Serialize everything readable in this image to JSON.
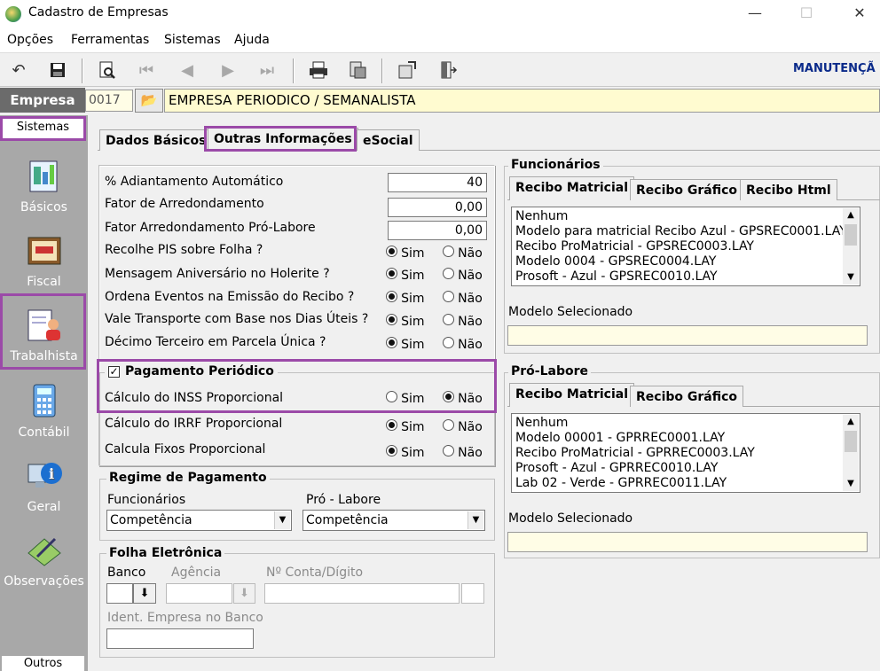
{
  "window": {
    "title": "Cadastro de Empresas",
    "minimize": "—",
    "maximize": "☐",
    "close": "✕"
  },
  "menu": [
    "Opções",
    "Ferramentas",
    "Sistemas",
    "Ajuda"
  ],
  "toolbar": {
    "status_text": "MANUTENÇÃ"
  },
  "empresa": {
    "label": "Empresa",
    "code": "0017",
    "name": "EMPRESA PERIODICO / SEMANALISTA"
  },
  "sidebar": {
    "header": "Sistemas",
    "items": [
      {
        "label": "Básicos",
        "icon": "basicos-icon"
      },
      {
        "label": "Fiscal",
        "icon": "fiscal-icon"
      },
      {
        "label": "Trabalhista",
        "icon": "trabalhista-icon"
      },
      {
        "label": "Contábil",
        "icon": "calculator-icon"
      },
      {
        "label": "Geral",
        "icon": "info-icon"
      },
      {
        "label": "Observações",
        "icon": "notes-icon"
      }
    ],
    "footer": "Outros"
  },
  "tabs": [
    "Dados Básicos",
    "Outras Informações",
    "eSocial"
  ],
  "fields": {
    "adiantamento": {
      "label": "% Adiantamento Automático",
      "value": "40"
    },
    "arredondamento": {
      "label": "Fator de Arredondamento",
      "value": "0,00"
    },
    "arred_prolabore": {
      "label": "Fator Arredondamento Pró-Labore",
      "value": "0,00"
    }
  },
  "radios": [
    {
      "label": "Recolhe PIS sobre Folha ?",
      "sim": true
    },
    {
      "label": "Mensagem Aniversário no Holerite ?",
      "sim": true
    },
    {
      "label": "Ordena Eventos na Emissão do Recibo ?",
      "sim": true
    },
    {
      "label": "Vale Transporte com Base nos Dias Úteis ?",
      "sim": true
    },
    {
      "label": "Décimo Terceiro em Parcela Única ?",
      "sim": true
    }
  ],
  "radio_sim": "Sim",
  "radio_nao": "Não",
  "pagamento_periodico": {
    "label": "Pagamento Periódico",
    "checked": true,
    "check_mark": "✓",
    "rows": [
      {
        "label": "Cálculo do INSS Proporcional",
        "sim": false
      },
      {
        "label": "Cálculo do IRRF Proporcional",
        "sim": true
      },
      {
        "label": "Calcula Fixos Proporcional",
        "sim": true
      }
    ]
  },
  "regime": {
    "title": "Regime de Pagamento",
    "funcionarios_label": "Funcionários",
    "funcionarios_value": "Competência",
    "prolabore_label": "Pró - Labore",
    "prolabore_value": "Competência"
  },
  "folha": {
    "title": "Folha Eletrônica",
    "banco": "Banco",
    "agencia": "Agência",
    "conta": "Nº Conta/Dígito",
    "ident": "Ident. Empresa no Banco"
  },
  "funcionarios": {
    "title": "Funcionários",
    "tabs": [
      "Recibo Matricial",
      "Recibo Gráfico",
      "Recibo Html"
    ],
    "items": [
      "Nenhum",
      "Modelo para matricial Recibo Azul - GPSREC0001.LAY",
      "Recibo ProMatricial - GPSREC0003.LAY",
      "Modelo 0004 - GPSREC0004.LAY",
      "Prosoft - Azul - GPSREC0010.LAY"
    ],
    "modelo_label": "Modelo Selecionado"
  },
  "prolabore": {
    "title": "Pró-Labore",
    "tabs": [
      "Recibo Matricial",
      "Recibo Gráfico"
    ],
    "items": [
      "Nenhum",
      "Modelo 00001 - GPRREC0001.LAY",
      "Recibo ProMatricial - GPRREC0003.LAY",
      "Prosoft - Azul - GPRREC0010.LAY",
      "Lab 02 - Verde - GPRREC0011.LAY"
    ],
    "modelo_label": "Modelo Selecionado"
  },
  "colors": {
    "highlight": "#9b4aa8",
    "sidebar": "#a8a8a8",
    "empresa_bg": "#6b6b6b",
    "name_bg": "#fffbd0"
  }
}
